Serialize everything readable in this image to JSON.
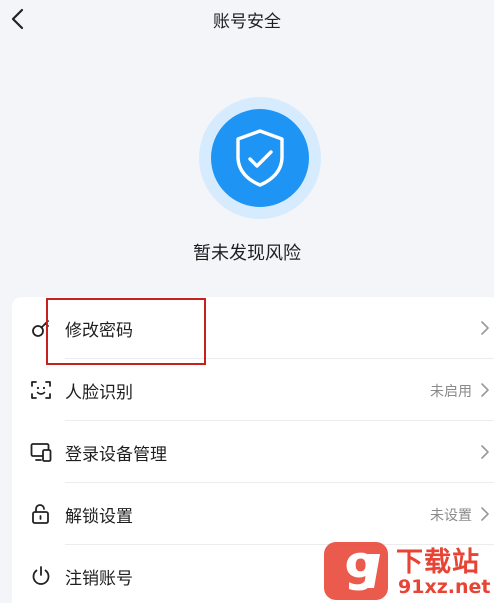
{
  "header": {
    "title": "账号安全",
    "back_icon": "back-chevron-icon"
  },
  "hero": {
    "icon": "shield-check-icon",
    "status_text": "暂未发现风险",
    "colors": {
      "shield": "#1e95f4",
      "halo": "#d6ebfd"
    }
  },
  "settings": {
    "items": [
      {
        "label": "修改密码",
        "value": "",
        "icon": "key-icon"
      },
      {
        "label": "人脸识别",
        "value": "未启用",
        "icon": "face-scan-icon"
      },
      {
        "label": "登录设备管理",
        "value": "",
        "icon": "devices-icon"
      },
      {
        "label": "解锁设置",
        "value": "未设置",
        "icon": "unlock-icon"
      },
      {
        "label": "注销账号",
        "value": "",
        "icon": "power-icon"
      }
    ]
  },
  "annotation": {
    "color": "#c8201d"
  },
  "watermark": {
    "logo_text": "9",
    "top_text": "下载站",
    "bottom_text": "91xz.net",
    "color": "#e74436"
  }
}
